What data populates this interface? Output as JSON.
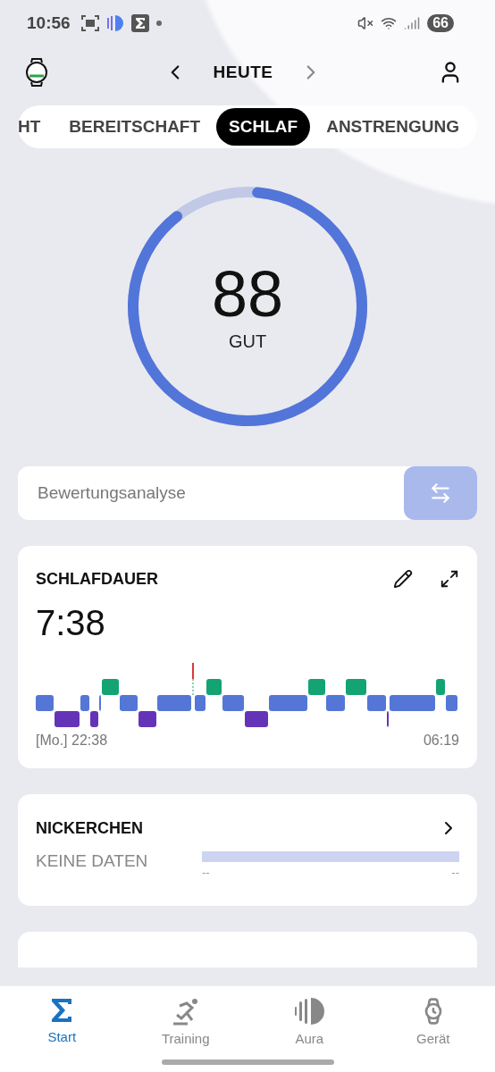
{
  "status_bar": {
    "time": "10:56",
    "battery": "66"
  },
  "header": {
    "title": "HEUTE"
  },
  "tabs": [
    {
      "label": "HT",
      "selected": false
    },
    {
      "label": "BEREITSCHAFT",
      "selected": false
    },
    {
      "label": "SCHLAF",
      "selected": true
    },
    {
      "label": "ANSTRENGUNG",
      "selected": false
    }
  ],
  "score": {
    "value": "88",
    "rating": "GUT",
    "level": 0.88
  },
  "analysis": {
    "label": "Bewertungsanalyse"
  },
  "sleep_card": {
    "title": "SCHLAFDAUER",
    "duration": "7:38",
    "start": "[Mo.] 22:38",
    "end": "06:19"
  },
  "nap_card": {
    "title": "NICKERCHEN",
    "status": "KEINE DATEN",
    "start": "--",
    "end": "--"
  },
  "bottom_nav": [
    {
      "label": "Start",
      "selected": true
    },
    {
      "label": "Training",
      "selected": false
    },
    {
      "label": "Aura",
      "selected": false
    },
    {
      "label": "Gerät",
      "selected": false
    }
  ]
}
